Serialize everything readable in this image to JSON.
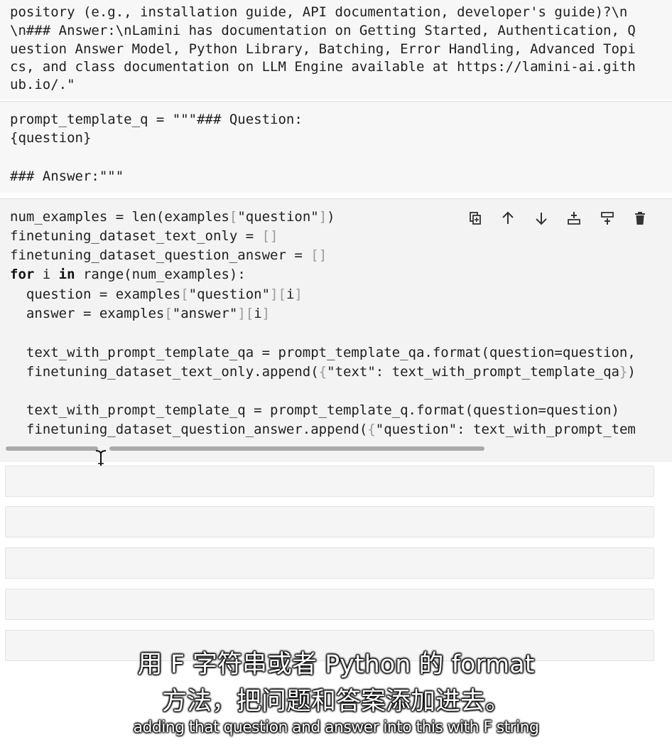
{
  "output_lines": [
    "pository (e.g., installation guide, API documentation, developer's guide)?\\n",
    "\\n### Answer:\\nLamini has documentation on Getting Started, Authentication, Q",
    "uestion Answer Model, Python Library, Batching, Error Handling, Advanced Topi",
    "cs, and class documentation on LLM Engine available at https://lamini-ai.gith",
    "ub.io/.\""
  ],
  "prompt_cell_lines": [
    "prompt_template_q = \"\"\"### Question:",
    "{question}",
    "",
    "### Answer:\"\"\""
  ],
  "code": {
    "l1": [
      "num_examples = len(examples",
      "[",
      "\"question\"",
      "]",
      ")"
    ],
    "l2": [
      "finetuning_dataset_text_only = ",
      "[]"
    ],
    "l3": [
      "finetuning_dataset_question_answer = ",
      "[]"
    ],
    "l4": [
      "for",
      " i ",
      "in",
      " range(num_examples):"
    ],
    "l5": [
      "  question = examples",
      "[",
      "\"question\"",
      "][",
      "i",
      "]"
    ],
    "l6": [
      "  answer = examples",
      "[",
      "\"answer\"",
      "][",
      "i",
      "]"
    ],
    "l7": "  text_with_prompt_template_qa = prompt_template_qa.format(question=question,",
    "l8": [
      "  finetuning_dataset_text_only.append(",
      "{",
      "\"text\": text_with_prompt_template_qa",
      "}",
      ")"
    ],
    "l9": "  text_with_prompt_template_q = prompt_template_q.format(question=question)",
    "l10": [
      "  finetuning_dataset_question_answer.append(",
      "{",
      "\"question\": text_with_prompt_tem"
    ]
  },
  "toolbar": {
    "duplicate_icon": "duplicate-icon",
    "move_up_icon": "arrow-up-icon",
    "move_down_icon": "arrow-down-icon",
    "insert_above_icon": "insert-above-icon",
    "insert_below_icon": "insert-below-icon",
    "delete_icon": "trash-icon"
  },
  "subtitles": {
    "cn_line1": "用 F 字符串或者 Python 的 format",
    "cn_line2": "方法，把问题和答案添加进去。",
    "en": "adding that question and answer into this with F string"
  }
}
